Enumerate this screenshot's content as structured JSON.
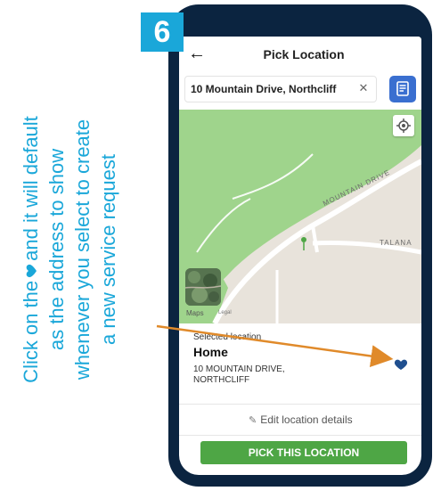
{
  "step_number": "6",
  "instruction": {
    "line1_before": "Click on the",
    "line1_after": "and it will default",
    "line2": "as the address to show",
    "line3": "whenever you select to create",
    "line4": "a new service request"
  },
  "header": {
    "back_icon": "arrow-left-icon",
    "title": "Pick Location"
  },
  "search": {
    "value": "10 Mountain Drive, Northcliff",
    "clear_icon": "close-icon",
    "saved_icon": "saved-addresses-icon"
  },
  "map": {
    "road_labels": [
      "MOUNTAIN DRIVE",
      "TALANA"
    ],
    "maps_logo": "Maps",
    "legal": "Legal",
    "location_icon": "my-location-icon"
  },
  "selected": {
    "label": "Selected location",
    "name": "Home",
    "address": "10 MOUNTAIN DRIVE, NORTHCLIFF",
    "favorite_icon": "heart-icon"
  },
  "actions": {
    "edit_label": "Edit location details",
    "edit_icon": "pencil-icon",
    "pick_label": "PICK THIS LOCATION"
  },
  "colors": {
    "accent": "#1aa7d9",
    "phone_frame": "#0b2440",
    "button_green": "#4ea645",
    "heart": "#1f4f8f",
    "arrow": "#e08a2a",
    "saved_button": "#3a6fd0"
  }
}
